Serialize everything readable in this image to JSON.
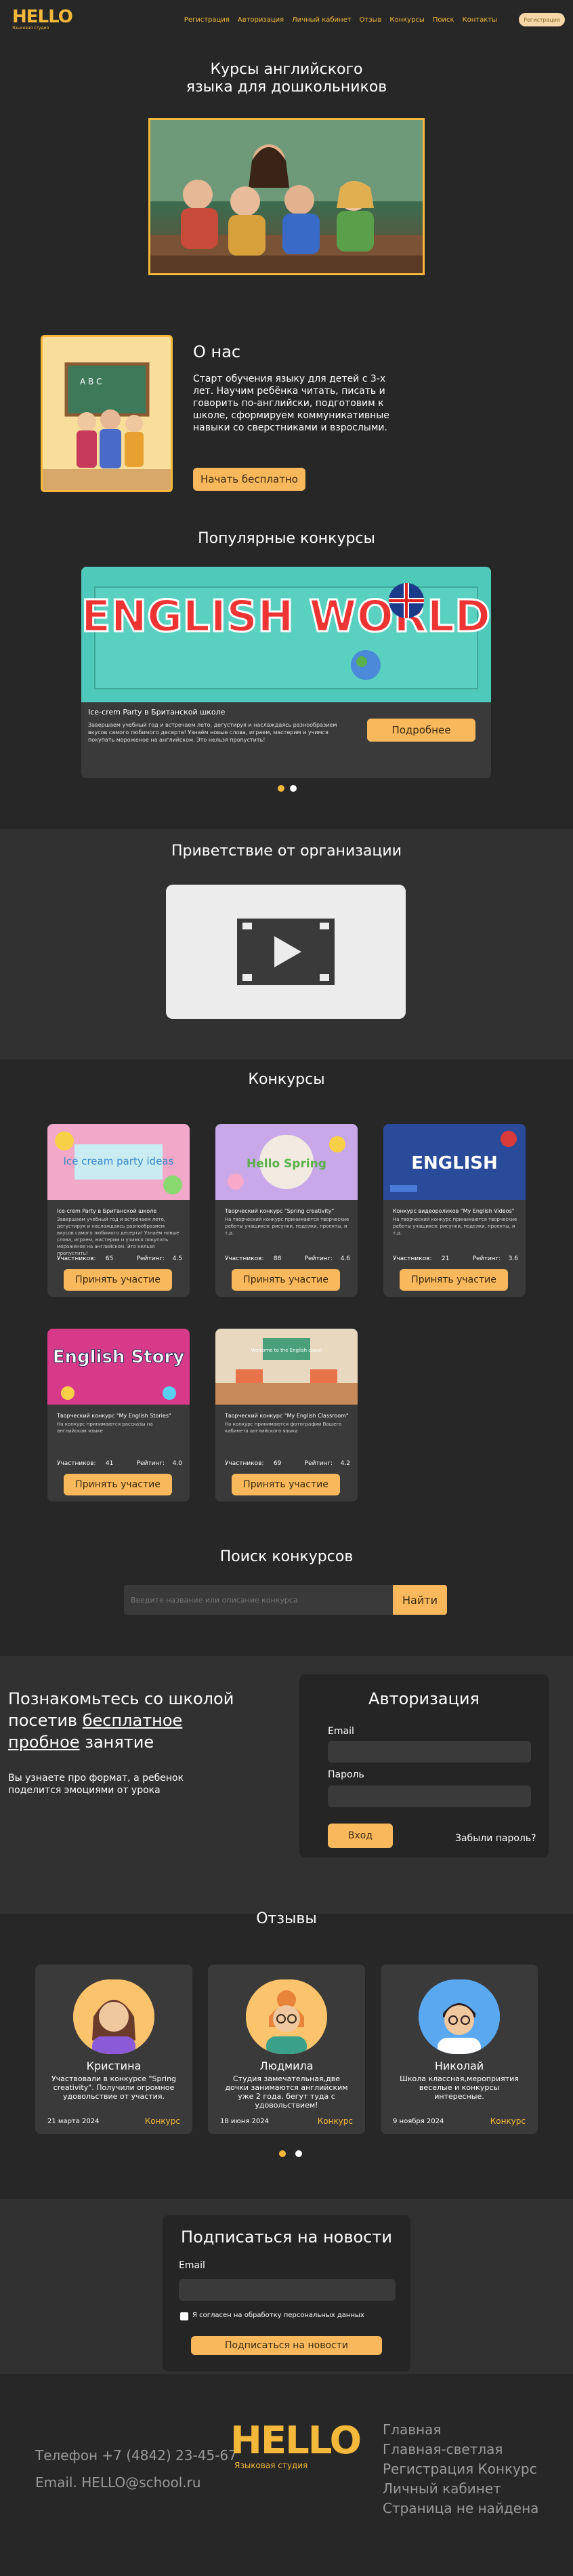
{
  "header": {
    "logo_word": "HELLO",
    "logo_sub": "Языковая студия",
    "nav": [
      "Регистрация",
      "Авторизация",
      "Личный кабинет",
      "Отзыв",
      "Конкурсы",
      "Поиск",
      "Контакты"
    ],
    "register_button": "Регистрация"
  },
  "hero": {
    "title_line1": "Курсы английского",
    "title_line2": "языка для дошкольников"
  },
  "about": {
    "title": "О нас",
    "text": "Старт обучения языку для детей с 3-х лет. Научим ребёнка читать, писать и говорить по-английски, подготовим к школе, сформируем коммуникативные навыки со сверстниками и взрослыми.",
    "button": "Начать бесплатно"
  },
  "popular": {
    "title": "Популярные конкурсы",
    "banner_text": "ENGLISH WORLD",
    "card_title": "Ice-crem Party в Британской школе",
    "card_desc": "Завершаем учебный год и встречаем лето, дегустируя и наслаждаясь разнообразием вкусов самого любимого десерта! Узнаём новые слова, играем, мастерим и учимся покупать мороженое на английском. Это нельзя пропустить!",
    "button": "Подробнее",
    "dots": 2
  },
  "welcome": {
    "title": "Приветствие от организации"
  },
  "contests": {
    "title": "Конкурсы",
    "participants_label": "Участников:",
    "rating_label": "Рейтинг:",
    "join_button": "Принять участие",
    "items": [
      {
        "image_text": "Ice cream party ideas",
        "title": "Ice-crem Party в Британской школе",
        "desc": "Завершаем учебный год и встречаем лето, дегустируя и наслаждаясь разнообразием вкусов самого любимого десерта! Узнаём новые слова, играем, мастерим и учимся покупать мороженое на английском. Это нельзя пропустить!",
        "participants": "65",
        "rating": "4.5"
      },
      {
        "image_text": "Hello Spring",
        "title": "Творческий конкурс \"Spring creativity\"",
        "desc": "На творческий конкурс принимаются творческие работы учащихся: рисунки, поделки, проекты, и т.д.",
        "participants": "88",
        "rating": "4.6"
      },
      {
        "image_text": "ENGLISH",
        "title": "Конкурс видеороликов \"My English Videos\"",
        "desc": "На творческий конкурс принимаются творческие работы учащихся: рисунки, поделки, проекты, и т.д.",
        "participants": "21",
        "rating": "3.6"
      },
      {
        "image_text": "English Story",
        "title": "Творческий конкурс \"My English Stories\"",
        "desc": "На конкурс принимаются рассказы на английском языке",
        "participants": "41",
        "rating": "4.0"
      },
      {
        "image_text": "Welcome to the English class!",
        "title": "Творческий конкурс \"My English Classroom\"",
        "desc": "На конкурс принимаются фотографии Вашего кабинета английского языка",
        "participants": "69",
        "rating": "4.2"
      }
    ]
  },
  "search": {
    "title": "Поиск конкурсов",
    "placeholder": "Введите название или описание конкурса",
    "button": "Найти"
  },
  "trial": {
    "line1": "Познакомьтесь со школой",
    "line2_a": "посетив ",
    "line2_b": "бесплатное",
    "line3_a": "пробное",
    "line3_b": " занятие",
    "subtitle": "Вы узнаете про формат, а ребенок поделится эмоциями от урока"
  },
  "auth": {
    "title": "Авторизация",
    "email_label": "Email",
    "password_label": "Пароль",
    "login_button": "Вход",
    "forgot": "Забыли пароль?"
  },
  "reviews": {
    "title": "Отзывы",
    "type_label": "Конкурс",
    "items": [
      {
        "name": "Кристина",
        "text": "Участвовали в конкурсе \"Spring creativity\". Получили огромное удовольствие от участия.",
        "date": "21 марта 2024"
      },
      {
        "name": "Людмила",
        "text": "Студия замечательная,две дочки занимаются английским уже 2 года, бегут туда с удовольствием!",
        "date": "18 июня 2024"
      },
      {
        "name": "Николай",
        "text": "Школа классная,мероприятия веселые и конкурсы интересные.",
        "date": "9 ноября 2024"
      }
    ]
  },
  "subscribe": {
    "title": "Подписаться на новости",
    "email_label": "Email",
    "consent": "Я согласен на обработку персональных данных",
    "button": "Подписаться на новости"
  },
  "footer": {
    "phone": "Телефон +7 (4842) 23-45-67",
    "email": "Email. HELLO@school.ru",
    "logo_word": "HELLO",
    "logo_sub": "Языковая студия",
    "links": [
      "Главная",
      "Главная-светлая",
      "Регистрация  Конкурс",
      "Личный кабинет",
      "Страница не найдена"
    ]
  },
  "colors": {
    "background": "#272727",
    "accent": "#f4b83a",
    "button": "#f9b85c",
    "card": "#3a3a3a"
  }
}
